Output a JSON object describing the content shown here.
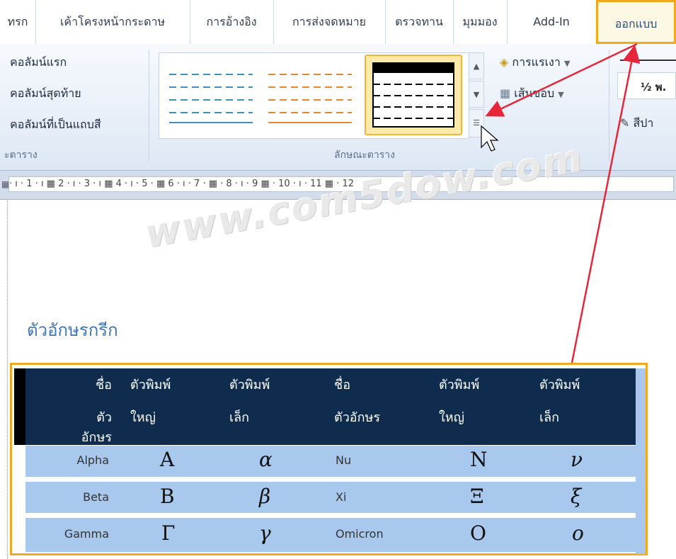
{
  "ribbon_tabs": [
    "ทรก",
    "เค้าโครงหน้ากระดาษ",
    "การอ้างอิง",
    "การส่งจดหมาย",
    "ตรวจทาน",
    "มุมมอง",
    "Add-In",
    "ออกแบบ"
  ],
  "options": {
    "first_column": "คอลัมน์แรก",
    "last_column": "คอลัมน์สุดท้าย",
    "banded_columns": "คอลัมน์ที่เป็นแถบสี",
    "group_label": "ะตาราง"
  },
  "styles_group_label": "ลักษณะตาราง",
  "shading_button": "การแรเงา",
  "borders_button": "เส้นขอบ",
  "pen_weight": "½ พ.",
  "pen_color": "สีปา",
  "ruler_text": "· ı · 1 · ı ▦ 2 · ı · 3 · ı ▦ 4 · ı · 5 · ▦ 6 · ı · 7 · ▦ · 8 · ı · 9 ▦ · 10 · ı · 11 ▦ · 12",
  "watermark": "www.com5dow.com",
  "document_heading": "ตัวอักษรกรีก",
  "table": {
    "headers": [
      [
        "ชื่อ",
        "ตัวอักษร"
      ],
      [
        "ตัวพิมพ์",
        "ใหญ่"
      ],
      [
        "ตัวพิมพ์",
        "เล็ก"
      ],
      [
        "ชื่อ",
        "ตัวอักษร"
      ],
      [
        "ตัวพิมพ์",
        "ใหญ่"
      ],
      [
        "ตัวพิมพ์",
        "เล็ก"
      ]
    ],
    "rows": [
      [
        "Alpha",
        "Α",
        "α",
        "Nu",
        "Ν",
        "ν"
      ],
      [
        "Beta",
        "Β",
        "β",
        "Xi",
        "Ξ",
        "ξ"
      ],
      [
        "Gamma",
        "Γ",
        "γ",
        "Omicron",
        "Ο",
        "ο"
      ]
    ]
  },
  "colors": {
    "accent_orange": "#f3a823",
    "table_header": "#0f2b4e",
    "table_row": "#a8c8ee",
    "arrow_red": "#e8263a"
  }
}
